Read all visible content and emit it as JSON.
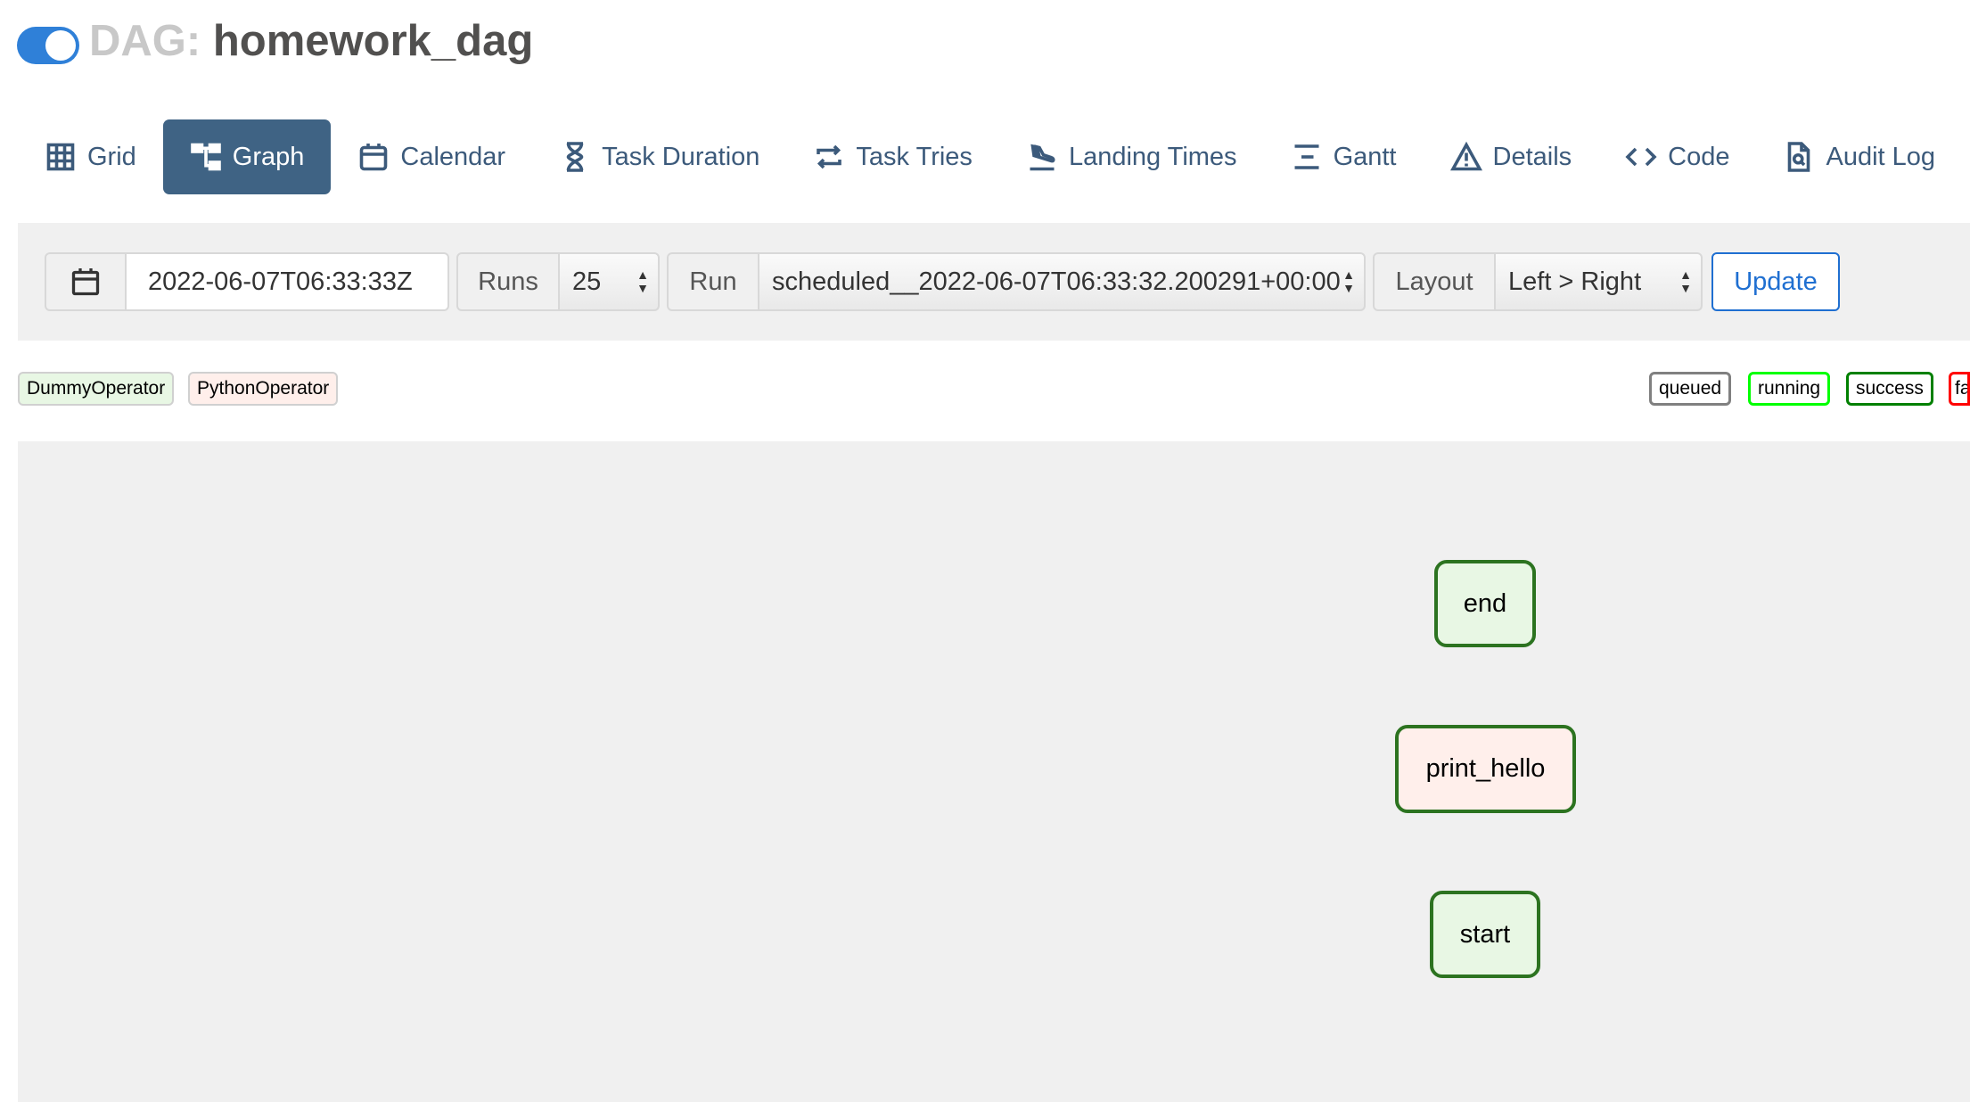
{
  "header": {
    "prefix": "DAG:",
    "dag_name": "homework_dag",
    "toggle_on": true
  },
  "nav": {
    "grid": "Grid",
    "graph": "Graph",
    "calendar": "Calendar",
    "task_duration": "Task Duration",
    "task_tries": "Task Tries",
    "landing_times": "Landing Times",
    "gantt": "Gantt",
    "details": "Details",
    "code": "Code",
    "audit_log": "Audit Log",
    "active": "Graph"
  },
  "controls": {
    "date_value": "2022-06-07T06:33:33Z",
    "runs_label": "Runs",
    "runs_value": "25",
    "run_label": "Run",
    "run_value": "scheduled__2022-06-07T06:33:32.200291+00:00",
    "layout_label": "Layout",
    "layout_value": "Left > Right",
    "update_label": "Update"
  },
  "operators": [
    {
      "label": "DummyOperator",
      "color": "#e8f7e4"
    },
    {
      "label": "PythonOperator",
      "color": "#ffefeb"
    }
  ],
  "states": [
    {
      "label": "queued",
      "color": "#808080"
    },
    {
      "label": "running",
      "color": "#00ff00"
    },
    {
      "label": "success",
      "color": "#008000"
    },
    {
      "label": "fa",
      "color": "#ff0000"
    }
  ],
  "graph": {
    "nodes": [
      {
        "label": "end",
        "operator": "DummyOperator",
        "fill": "#e8f7e4",
        "state_color": "#2c7320"
      },
      {
        "label": "print_hello",
        "operator": "PythonOperator",
        "fill": "#ffefeb",
        "state_color": "#2c7320"
      },
      {
        "label": "start",
        "operator": "DummyOperator",
        "fill": "#e8f7e4",
        "state_color": "#2c7320"
      }
    ]
  }
}
